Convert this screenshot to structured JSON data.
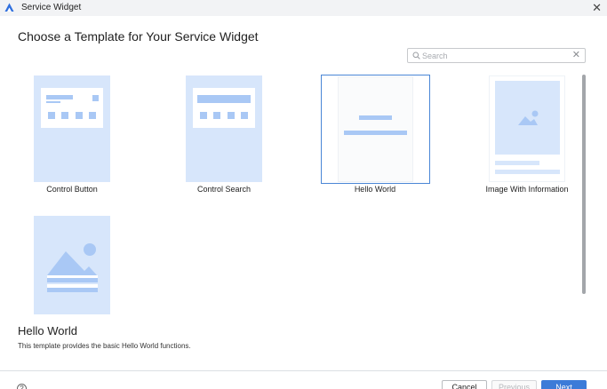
{
  "window": {
    "title": "Service Widget",
    "app_icon": "harmony-logo-icon",
    "close_icon": "close-icon",
    "close_glyph": "✕"
  },
  "heading": "Choose a Template for Your Service Widget",
  "search": {
    "placeholder": "Search",
    "value": "",
    "icon": "search-icon",
    "clear_glyph": "✕"
  },
  "templates": [
    {
      "label": "Control Button",
      "selected": false
    },
    {
      "label": "Control Search",
      "selected": false
    },
    {
      "label": "Hello World",
      "selected": true
    },
    {
      "label": "Image With Information",
      "selected": false
    }
  ],
  "preview": {
    "icon": "image-landscape-icon"
  },
  "description": {
    "title": "Hello World",
    "text": "This template provides the basic Hello World functions."
  },
  "footer": {
    "help_glyph": "?",
    "cancel_label": "Cancel",
    "previous_label": "Previous",
    "next_label": "Next",
    "previous_disabled": true
  },
  "colors": {
    "accent": "#3c7bd8",
    "thumb_bg": "#d7e6fb",
    "thumb_mark": "#a9c8f5",
    "selection_border": "#4a86d6"
  }
}
